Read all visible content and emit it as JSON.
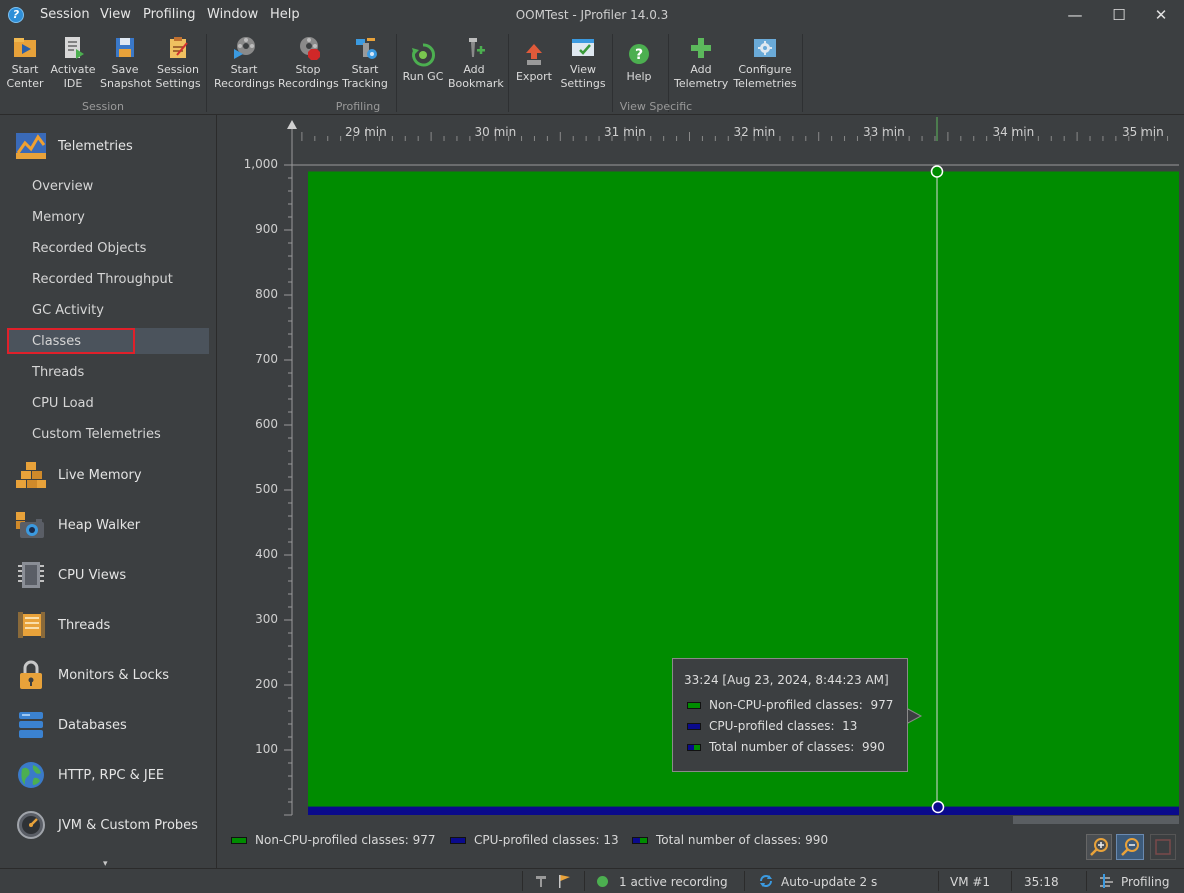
{
  "window": {
    "title": "OOMTest - JProfiler 14.0.3",
    "menu": [
      "Session",
      "View",
      "Profiling",
      "Window",
      "Help"
    ],
    "controls": {
      "minimize": "—",
      "maximize": "☐",
      "close": "✕"
    }
  },
  "toolbar": {
    "groups": [
      {
        "label": "Session",
        "buttons": [
          {
            "line1": "Start",
            "line2": "Center",
            "icon": "start-center-icon"
          },
          {
            "line1": "Activate",
            "line2": "IDE",
            "icon": "activate-ide-icon"
          },
          {
            "line1": "Save",
            "line2": "Snapshot",
            "icon": "save-snapshot-icon"
          },
          {
            "line1": "Session",
            "line2": "Settings",
            "icon": "session-settings-icon"
          }
        ]
      },
      {
        "label": "Profiling",
        "buttons": [
          {
            "line1": "Start",
            "line2": "Recordings",
            "icon": "start-recordings-icon"
          },
          {
            "line1": "Stop",
            "line2": "Recordings",
            "icon": "stop-recordings-icon"
          },
          {
            "line1": "Start",
            "line2": "Tracking",
            "icon": "start-tracking-icon"
          },
          {
            "line1": "Run GC",
            "line2": "",
            "icon": "run-gc-icon"
          },
          {
            "line1": "Add",
            "line2": "Bookmark",
            "icon": "add-bookmark-icon"
          }
        ]
      },
      {
        "label": "View Specific",
        "buttons": [
          {
            "line1": "Export",
            "line2": "",
            "icon": "export-icon"
          },
          {
            "line1": "View",
            "line2": "Settings",
            "icon": "view-settings-icon"
          },
          {
            "line1": "Help",
            "line2": "",
            "icon": "help-icon"
          },
          {
            "line1": "Add",
            "line2": "Telemetry",
            "icon": "add-telemetry-icon"
          },
          {
            "line1": "Configure",
            "line2": "Telemetries",
            "icon": "configure-telemetries-icon"
          }
        ]
      }
    ]
  },
  "sidebar": {
    "telemetries": {
      "label": "Telemetries",
      "items": [
        "Overview",
        "Memory",
        "Recorded Objects",
        "Recorded Throughput",
        "GC Activity",
        "Classes",
        "Threads",
        "CPU Load",
        "Custom Telemetries"
      ],
      "selected": "Classes"
    },
    "sections": [
      {
        "label": "Live Memory",
        "icon": "live-memory-icon"
      },
      {
        "label": "Heap Walker",
        "icon": "heap-walker-icon"
      },
      {
        "label": "CPU Views",
        "icon": "cpu-views-icon"
      },
      {
        "label": "Threads",
        "icon": "threads-icon"
      },
      {
        "label": "Monitors & Locks",
        "icon": "monitors-locks-icon"
      },
      {
        "label": "Databases",
        "icon": "databases-icon"
      },
      {
        "label": "HTTP, RPC & JEE",
        "icon": "http-rpc-jee-icon"
      },
      {
        "label": "JVM & Custom Probes",
        "icon": "jvm-custom-probes-icon"
      }
    ]
  },
  "chart_data": {
    "type": "area",
    "x_ticks": [
      "29 min",
      "30 min",
      "31 min",
      "32 min",
      "33 min",
      "34 min",
      "35 min"
    ],
    "y_ticks": [
      "1,000",
      "900",
      "800",
      "700",
      "600",
      "500",
      "400",
      "300",
      "200",
      "100"
    ],
    "ylim": [
      0,
      1000
    ],
    "series": [
      {
        "name": "Non-CPU-profiled classes",
        "value": 977,
        "color": "#008c00"
      },
      {
        "name": "CPU-profiled classes",
        "value": 13,
        "color": "#0a0a8c"
      },
      {
        "name": "Total number of classes",
        "value": 990,
        "color": "#008c00"
      }
    ],
    "cursor": {
      "time": "33:24 [Aug 23, 2024, 8:44:23 AM]",
      "rows": [
        {
          "label": "Non-CPU-profiled classes:",
          "value": "977"
        },
        {
          "label": "CPU-profiled classes:",
          "value": "13"
        },
        {
          "label": "Total number of classes:",
          "value": "990"
        }
      ]
    },
    "legend": [
      {
        "label": "Non-CPU-profiled classes:",
        "value": "977"
      },
      {
        "label": "CPU-profiled classes:",
        "value": "13"
      },
      {
        "label": "Total number of classes:",
        "value": "990"
      }
    ]
  },
  "statusbar": {
    "recording": "1 active recording",
    "autoupdate": "Auto-update 2 s",
    "vm": "VM #1",
    "time": "35:18",
    "mode": "Profiling"
  }
}
